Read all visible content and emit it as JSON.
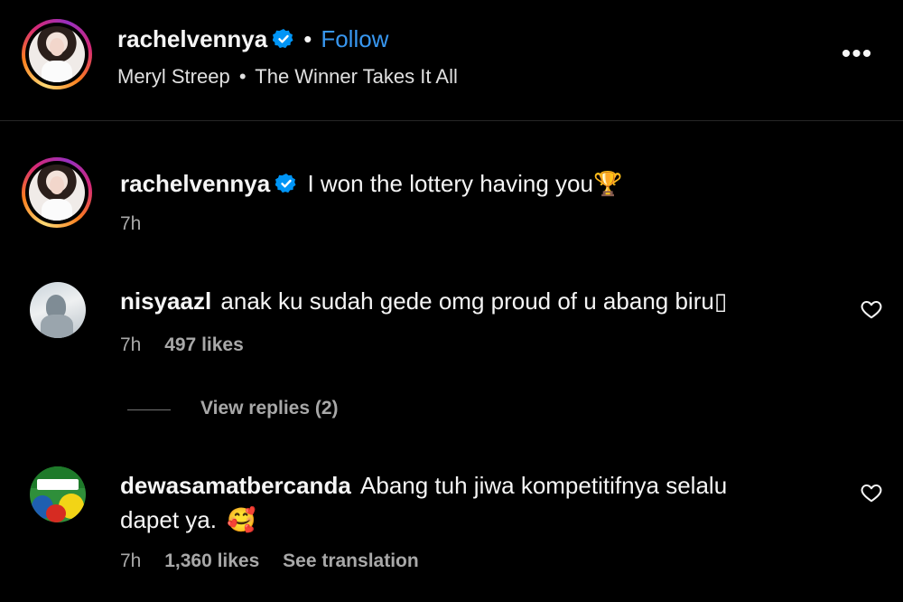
{
  "header": {
    "username": "rachelvennya",
    "follow_label": "Follow",
    "dot": "•",
    "song_artist": "Meryl Streep",
    "song_sep": "•",
    "song_title": "The Winner Takes It All",
    "more_label": "•••"
  },
  "caption": {
    "username": "rachelvennya",
    "text": "I won the lottery having you",
    "emoji": "🏆",
    "time": "7h"
  },
  "comments": [
    {
      "username": "nisyaazl",
      "text": "anak ku sudah gede omg proud of u abang biru▯",
      "time": "7h",
      "likes": "497 likes",
      "view_replies": "View replies (2)"
    },
    {
      "username": "dewasamatbercanda",
      "text_line1": "Abang tuh jiwa kompetitifnya selalu",
      "text_line2": "dapet ya.",
      "emoji": "🥰",
      "time": "7h",
      "likes": "1,360 likes",
      "see_translation": "See translation"
    }
  ],
  "colors": {
    "background": "#000000",
    "link_blue": "#3897f0",
    "secondary_text": "#a8a8a8",
    "verified_blue": "#0095f6"
  },
  "icons": {
    "verified": "verified-badge-icon",
    "more": "more-options-icon",
    "like": "heart-outline-icon"
  }
}
